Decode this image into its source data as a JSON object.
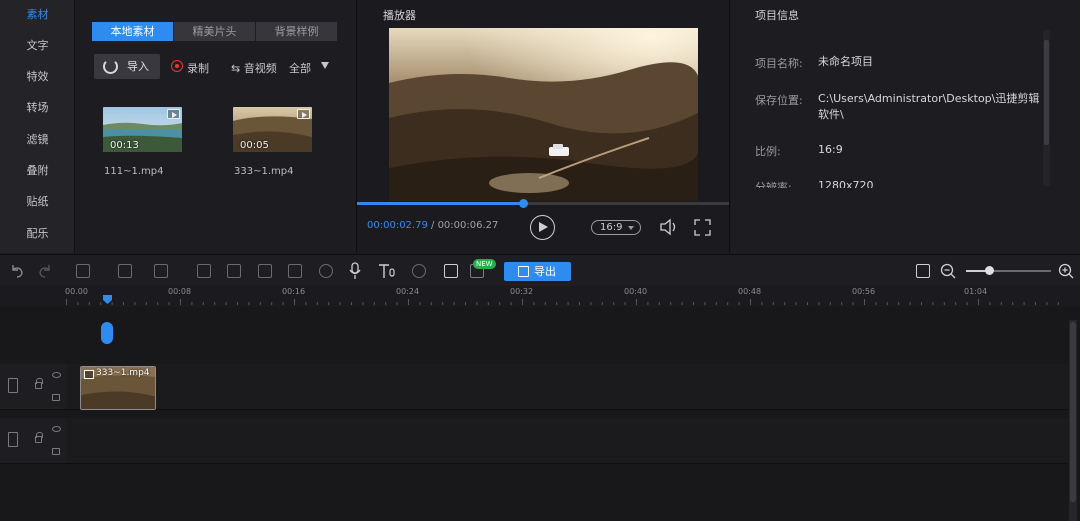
{
  "sidebar": {
    "items": [
      {
        "label": "素材",
        "active": true
      },
      {
        "label": "文字"
      },
      {
        "label": "特效"
      },
      {
        "label": "转场"
      },
      {
        "label": "滤镜"
      },
      {
        "label": "叠附"
      },
      {
        "label": "贴纸"
      },
      {
        "label": "配乐"
      }
    ]
  },
  "media": {
    "tabs": [
      {
        "label": "本地素材",
        "active": true
      },
      {
        "label": "精美片头"
      },
      {
        "label": "背景样例"
      }
    ],
    "import_label": "导入",
    "record_label": "录制",
    "mode_label": "⇆ 音视频",
    "filter_label": "全部",
    "items": [
      {
        "name": "111~1.mp4",
        "duration": "00:13"
      },
      {
        "name": "333~1.mp4",
        "duration": "00:05"
      }
    ]
  },
  "player": {
    "title": "播放器",
    "current_time": "00:00:02.79",
    "separator": " / ",
    "total_time": "00:00:06.27",
    "progress": 0.445,
    "ratio": "16:9"
  },
  "info": {
    "title": "项目信息",
    "fields": [
      {
        "label": "项目名称:",
        "value": "未命名项目"
      },
      {
        "label": "保存位置:",
        "value": "C:\\Users\\Administrator\\Desktop\\迅捷剪辑软件\\"
      },
      {
        "label": "比例:",
        "value": "16:9"
      },
      {
        "label": "分辨率:",
        "value": "1280x720"
      }
    ]
  },
  "toolbar": {
    "export_label": "导出",
    "new_badge": "NEW",
    "zoom_level": 0.27
  },
  "ruler": {
    "labels": [
      "00.00",
      "00:08",
      "00:16",
      "00:24",
      "00:32",
      "00:40",
      "00:48",
      "00:56",
      "01:04"
    ]
  },
  "timeline": {
    "clip_name": "333~1.mp4"
  },
  "colors": {
    "accent": "#2e8cf0",
    "badge": "#25b04a"
  }
}
